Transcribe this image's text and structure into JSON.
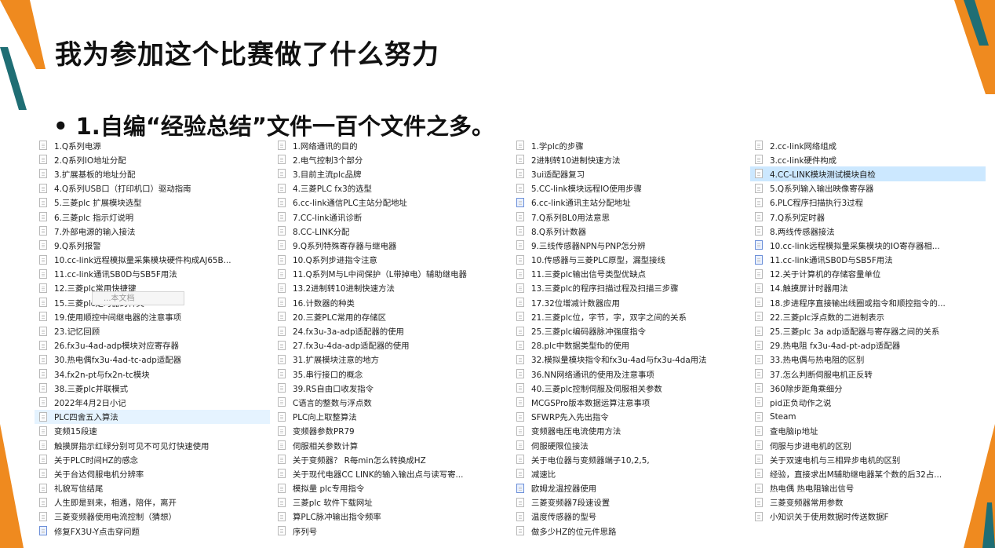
{
  "slide": {
    "title": "我为参加这个比赛做了什么努力",
    "subtitle": "• 1.自编“经验总结”文件一百个文件之多。",
    "accent_orange": "#ef8a1f",
    "accent_teal": "#1f6e74"
  },
  "explorer": {
    "tooltip": "...本文档",
    "columns": [
      {
        "items": [
          {
            "label": "1.Q系列电源",
            "icon": "doc-icon"
          },
          {
            "label": "2.Q系列IO地址分配",
            "icon": "doc-icon"
          },
          {
            "label": "3.扩展基板的地址分配",
            "icon": "doc-icon"
          },
          {
            "label": "4.Q系列USB口（打印机口）驱动指南",
            "icon": "doc-icon"
          },
          {
            "label": "5.三菱plc 扩展模块选型",
            "icon": "doc-icon"
          },
          {
            "label": "6.三菱plc 指示灯说明",
            "icon": "doc-icon"
          },
          {
            "label": "7.外部电源的输入接法",
            "icon": "doc-icon"
          },
          {
            "label": "9.Q系列报警",
            "icon": "doc-icon"
          },
          {
            "label": "10.cc-link远程模拟量采集模块硬件构成AJ65B...",
            "icon": "doc-icon"
          },
          {
            "label": "11.cc-link通讯SB0D与SB5F用法",
            "icon": "doc-icon"
          },
          {
            "label": "12.三菱plc常用快捷键",
            "icon": "doc-icon"
          },
          {
            "label": "15.三菱plc定时器的种类",
            "icon": "doc-icon"
          },
          {
            "label": "19.使用顺控中间继电器的注意事项",
            "icon": "doc-icon"
          },
          {
            "label": "23.记忆回顾",
            "icon": "doc-icon"
          },
          {
            "label": "26.fx3u-4ad-adp模块对应寄存器",
            "icon": "doc-icon"
          },
          {
            "label": "30.热电偶fx3u-4ad-tc-adp适配器",
            "icon": "doc-icon"
          },
          {
            "label": "34.fx2n-pt与fx2n-tc模块",
            "icon": "doc-icon"
          },
          {
            "label": "38.三菱plc并联模式",
            "icon": "doc-icon"
          },
          {
            "label": "2022年4月2日小记",
            "icon": "doc-icon"
          },
          {
            "label": "PLC四舍五入算法",
            "icon": "doc-icon",
            "state": "hover"
          },
          {
            "label": "变频15段速",
            "icon": "doc-icon"
          },
          {
            "label": "触摸屏指示红绿分别可见不可见灯快速使用",
            "icon": "doc-icon"
          },
          {
            "label": "关于PLC时间HZ的感念",
            "icon": "doc-icon"
          },
          {
            "label": "关于台达伺服电机分辨率",
            "icon": "doc-icon"
          },
          {
            "label": "礼貌写信结尾",
            "icon": "doc-icon"
          },
          {
            "label": "人生即是到来，相遇，陪伴，离开",
            "icon": "doc-icon"
          },
          {
            "label": "三菱变频器使用电流控制（猜想）",
            "icon": "doc-icon"
          },
          {
            "label": "修复FX3U-Y点击穿问题",
            "icon": "doc-blue-icon"
          }
        ]
      },
      {
        "items": [
          {
            "label": "1.网络通讯的目的",
            "icon": "doc-icon"
          },
          {
            "label": "2.电气控制3个部分",
            "icon": "doc-icon"
          },
          {
            "label": "3.目前主流plc品牌",
            "icon": "doc-icon"
          },
          {
            "label": "4.三菱PLC  fx3的选型",
            "icon": "doc-icon"
          },
          {
            "label": "6.cc-link通信PLC主站分配地址",
            "icon": "doc-icon"
          },
          {
            "label": "7.CC-link通讯诊断",
            "icon": "doc-icon"
          },
          {
            "label": "8.CC-LINK分配",
            "icon": "doc-icon"
          },
          {
            "label": "9.Q系列特殊寄存器与继电器",
            "icon": "doc-icon"
          },
          {
            "label": "10.Q系列步进指令注意",
            "icon": "doc-icon"
          },
          {
            "label": "11.Q系列M与L中间保护（L带掉电）辅助继电器",
            "icon": "doc-icon"
          },
          {
            "label": "13.2进制转10进制快速方法",
            "icon": "doc-icon"
          },
          {
            "label": "16.计数器的种类",
            "icon": "doc-icon"
          },
          {
            "label": "20.三菱PLC常用的存储区",
            "icon": "doc-icon"
          },
          {
            "label": "24.fx3u-3a-adp适配器的使用",
            "icon": "doc-icon"
          },
          {
            "label": "27.fx3u-4da-adp适配器的使用",
            "icon": "doc-icon"
          },
          {
            "label": "31.扩展模块注意的地方",
            "icon": "doc-icon"
          },
          {
            "label": "35.串行接口的概念",
            "icon": "doc-icon"
          },
          {
            "label": "39.RS自由口收发指令",
            "icon": "doc-icon"
          },
          {
            "label": "C语言的整数与浮点数",
            "icon": "doc-icon"
          },
          {
            "label": "PLC向上取整算法",
            "icon": "doc-icon"
          },
          {
            "label": "变频器参数PR79",
            "icon": "doc-icon"
          },
          {
            "label": "伺服相关参数计算",
            "icon": "doc-icon"
          },
          {
            "label": "关于变频器？ R每min怎么转换成HZ",
            "icon": "doc-icon"
          },
          {
            "label": "关于现代电器CC LINK的输入输出点与读写寄...",
            "icon": "doc-icon"
          },
          {
            "label": "模拟量 plc专用指令",
            "icon": "doc-icon"
          },
          {
            "label": "三菱plc 软件下载网址",
            "icon": "doc-icon"
          },
          {
            "label": "算PLC脉冲输出指令频率",
            "icon": "doc-icon"
          },
          {
            "label": "序列号",
            "icon": "doc-icon"
          }
        ]
      },
      {
        "items": [
          {
            "label": "1.学plc的步骤",
            "icon": "doc-icon"
          },
          {
            "label": "2进制转10进制快速方法",
            "icon": "doc-icon"
          },
          {
            "label": "3ui适配器复习",
            "icon": "doc-icon"
          },
          {
            "label": "5.CC-link模块远程IO使用步骤",
            "icon": "doc-icon"
          },
          {
            "label": "6.cc-link通讯主站分配地址",
            "icon": "doc-blue-icon"
          },
          {
            "label": "7.Q系列BL0用法意思",
            "icon": "doc-icon"
          },
          {
            "label": "8.Q系列计数器",
            "icon": "doc-icon"
          },
          {
            "label": "9.三线传感器NPN与PNP怎分辨",
            "icon": "doc-icon"
          },
          {
            "label": "10.传感器与三菱PLC原型，漏型接线",
            "icon": "doc-icon"
          },
          {
            "label": "11.三菱plc输出信号类型优缺点",
            "icon": "doc-icon"
          },
          {
            "label": "13.三菱plc的程序扫描过程及扫描三步骤",
            "icon": "doc-icon"
          },
          {
            "label": "17.32位增减计数器应用",
            "icon": "doc-icon"
          },
          {
            "label": "21.三菱plc位，字节，字，双字之间的关系",
            "icon": "doc-icon"
          },
          {
            "label": "25.三菱plc编码器脉冲强度指令",
            "icon": "doc-icon"
          },
          {
            "label": "28.plc中数据类型fb的使用",
            "icon": "doc-icon"
          },
          {
            "label": "32.模拟量模块指令和fx3u-4ad与fx3u-4da用法",
            "icon": "doc-icon"
          },
          {
            "label": "36.NN网络通讯的使用及注意事项",
            "icon": "doc-icon"
          },
          {
            "label": "40.三菱plc控制伺服及伺服相关参数",
            "icon": "doc-icon"
          },
          {
            "label": "MCGSPro版本数据运算注意事项",
            "icon": "doc-icon"
          },
          {
            "label": "SFWRP先入先出指令",
            "icon": "doc-icon"
          },
          {
            "label": "变频器电压电流使用方法",
            "icon": "doc-icon"
          },
          {
            "label": "伺服硬限位接法",
            "icon": "doc-icon"
          },
          {
            "label": "关于电位器与变频器端子10,2,5,",
            "icon": "doc-icon"
          },
          {
            "label": "减速比",
            "icon": "doc-icon"
          },
          {
            "label": "欧姆龙温控器使用",
            "icon": "doc-blue-icon"
          },
          {
            "label": "三菱变频器7段速设置",
            "icon": "doc-icon"
          },
          {
            "label": "温度传感器的型号",
            "icon": "doc-icon"
          },
          {
            "label": "做多少HZ的位元件思路",
            "icon": "doc-icon"
          }
        ]
      },
      {
        "items": [
          {
            "label": "2.cc-link网络组成",
            "icon": "doc-icon"
          },
          {
            "label": "3.cc-link硬件构成",
            "icon": "doc-icon"
          },
          {
            "label": "4.CC-LINK模块测试模块自检",
            "icon": "doc-icon",
            "state": "selected"
          },
          {
            "label": "5.Q系列输入输出映像寄存器",
            "icon": "doc-icon"
          },
          {
            "label": "6.PLC程序扫描执行3过程",
            "icon": "doc-icon"
          },
          {
            "label": "7.Q系列定时器",
            "icon": "doc-icon"
          },
          {
            "label": "8.两线传感器接法",
            "icon": "doc-icon"
          },
          {
            "label": "10.cc-link远程模拟量采集模块的IO寄存器相...",
            "icon": "doc-blue-icon"
          },
          {
            "label": "11.cc-link通讯SB0D与SB5F用法",
            "icon": "doc-blue-icon"
          },
          {
            "label": "12.关于计算机的存储容量单位",
            "icon": "doc-icon"
          },
          {
            "label": "14.触摸屏计时器用法",
            "icon": "doc-icon"
          },
          {
            "label": "18.步进程序直接输出线圈或指令和顺控指令的...",
            "icon": "doc-icon"
          },
          {
            "label": "22.三菱plc浮点数的二进制表示",
            "icon": "doc-icon"
          },
          {
            "label": "25.三菱plc 3a adp适配器与寄存器之间的关系",
            "icon": "doc-icon"
          },
          {
            "label": "29.热电阻 fx3u-4ad-pt-adp适配器",
            "icon": "doc-icon"
          },
          {
            "label": "33.热电偶与热电阻的区别",
            "icon": "doc-icon"
          },
          {
            "label": "37.怎么判断伺服电机正反转",
            "icon": "doc-icon"
          },
          {
            "label": "360除步距角乘细分",
            "icon": "doc-icon"
          },
          {
            "label": "pid正负动作之说",
            "icon": "doc-icon"
          },
          {
            "label": "Steam",
            "icon": "doc-icon"
          },
          {
            "label": "查电脑ip地址",
            "icon": "doc-icon"
          },
          {
            "label": "伺服与步进电机的区别",
            "icon": "doc-icon"
          },
          {
            "label": "关于双速电机与三相异步电机的区别",
            "icon": "doc-icon"
          },
          {
            "label": "经验，直接求出M辅助继电器某个数的后32占...",
            "icon": "doc-icon"
          },
          {
            "label": "热电偶 热电阻输出信号",
            "icon": "doc-icon"
          },
          {
            "label": "三菱变频器常用参数",
            "icon": "doc-icon"
          },
          {
            "label": "小知识关于使用数据时传送数据F",
            "icon": "doc-icon"
          }
        ]
      }
    ]
  }
}
